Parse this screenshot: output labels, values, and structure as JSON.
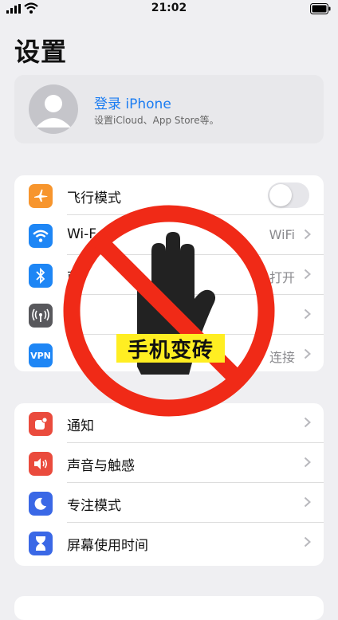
{
  "status_bar": {
    "time": "21:02"
  },
  "page": {
    "title": "设置"
  },
  "account": {
    "title": "登录 iPhone",
    "subtitle": "设置iCloud、App Store等。"
  },
  "network_rows": [
    {
      "label": "飞行模式",
      "icon": "airplane-icon",
      "color": "#f7952d"
    },
    {
      "label": "Wi-F",
      "value": "WiFi",
      "icon": "wifi-icon",
      "color": "#1e86f5"
    },
    {
      "label": "蓝",
      "value": "打开",
      "icon": "bluetooth-icon",
      "color": "#1e86f5"
    },
    {
      "label": "",
      "icon": "cellular-icon",
      "color": "#58585c"
    },
    {
      "label": "",
      "value": "连接",
      "icon": "vpn-icon",
      "icon_text": "VPN",
      "color": "#1e86f5"
    }
  ],
  "notification_rows": [
    {
      "label": "通知",
      "icon": "bell-icon",
      "color": "#ea4b3d"
    },
    {
      "label": "声音与触感",
      "icon": "speaker-icon",
      "color": "#ea4b3d"
    },
    {
      "label": "专注模式",
      "icon": "moon-icon",
      "color": "#3a68e6"
    },
    {
      "label": "屏幕使用时间",
      "icon": "hourglass-icon",
      "color": "#3a68e6"
    }
  ],
  "overlay": {
    "banner_text": "手机变砖",
    "ring_color": "#f02a17",
    "hand_color": "#222222",
    "banner_color": "#ffee22"
  }
}
